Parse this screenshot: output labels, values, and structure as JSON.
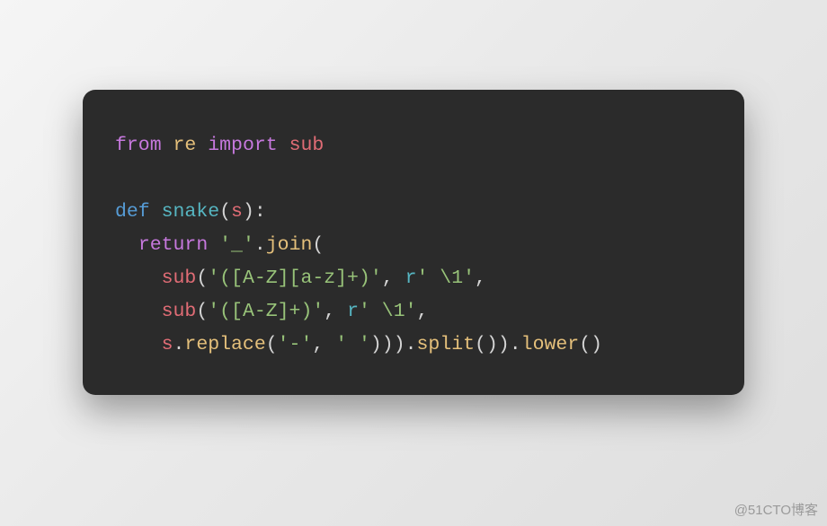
{
  "code": {
    "l1": {
      "kw_from": "from",
      "mod": "re",
      "kw_import": "import",
      "id": "sub"
    },
    "l3": {
      "kw_def": "def",
      "fn": "snake",
      "open": "(",
      "param": "s",
      "close": "):"
    },
    "l4": {
      "kw_return": "return",
      "str": "'_'",
      "dot": ".",
      "call": "join",
      "open": "("
    },
    "l5": {
      "id": "sub",
      "open": "(",
      "str": "'([A-Z][a-z]+)'",
      "comma": ",",
      "raw": "r",
      "rstr": "' \\1'",
      "close": ","
    },
    "l6": {
      "id": "sub",
      "open": "(",
      "str": "'([A-Z]+)'",
      "comma": ",",
      "raw": "r",
      "rstr": "' \\1'",
      "close": ","
    },
    "l7": {
      "id": "s",
      "dot": ".",
      "c1": "replace",
      "o1": "(",
      "s1": "'-'",
      "cm": ",",
      "s2": "' '",
      "cl1": ")))",
      "d2": ".",
      "c2": "split",
      "p2": "())",
      "d3": ".",
      "c3": "lower",
      "p3": "()"
    }
  },
  "watermark": "@51CTO博客"
}
